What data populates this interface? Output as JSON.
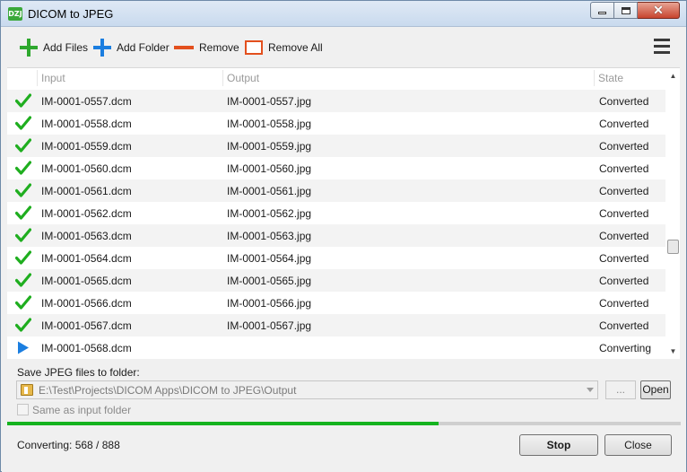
{
  "window": {
    "title": "DICOM to JPEG",
    "app_icon_text": "DZJ"
  },
  "toolbar": {
    "add_files": "Add Files",
    "add_folder": "Add Folder",
    "remove": "Remove",
    "remove_all": "Remove All"
  },
  "list": {
    "columns": {
      "input": "Input",
      "output": "Output",
      "state": "State"
    },
    "rows": [
      {
        "input": "IM-0001-0557.dcm",
        "output": "IM-0001-0557.jpg",
        "state": "Converted",
        "icon": "check-icon"
      },
      {
        "input": "IM-0001-0558.dcm",
        "output": "IM-0001-0558.jpg",
        "state": "Converted",
        "icon": "check-icon"
      },
      {
        "input": "IM-0001-0559.dcm",
        "output": "IM-0001-0559.jpg",
        "state": "Converted",
        "icon": "check-icon"
      },
      {
        "input": "IM-0001-0560.dcm",
        "output": "IM-0001-0560.jpg",
        "state": "Converted",
        "icon": "check-icon"
      },
      {
        "input": "IM-0001-0561.dcm",
        "output": "IM-0001-0561.jpg",
        "state": "Converted",
        "icon": "check-icon"
      },
      {
        "input": "IM-0001-0562.dcm",
        "output": "IM-0001-0562.jpg",
        "state": "Converted",
        "icon": "check-icon"
      },
      {
        "input": "IM-0001-0563.dcm",
        "output": "IM-0001-0563.jpg",
        "state": "Converted",
        "icon": "check-icon"
      },
      {
        "input": "IM-0001-0564.dcm",
        "output": "IM-0001-0564.jpg",
        "state": "Converted",
        "icon": "check-icon"
      },
      {
        "input": "IM-0001-0565.dcm",
        "output": "IM-0001-0565.jpg",
        "state": "Converted",
        "icon": "check-icon"
      },
      {
        "input": "IM-0001-0566.dcm",
        "output": "IM-0001-0566.jpg",
        "state": "Converted",
        "icon": "check-icon"
      },
      {
        "input": "IM-0001-0567.dcm",
        "output": "IM-0001-0567.jpg",
        "state": "Converted",
        "icon": "check-icon"
      },
      {
        "input": "IM-0001-0568.dcm",
        "output": "",
        "state": "Converting",
        "icon": "play-icon"
      }
    ]
  },
  "output": {
    "label": "Save JPEG files to folder:",
    "path": "E:\\Test\\Projects\\DICOM Apps\\DICOM to JPEG\\Output",
    "browse_label": "...",
    "open_label": "Open",
    "same_as_input_label": "Same as input folder",
    "same_as_input_checked": false
  },
  "progress": {
    "fraction": 0.64
  },
  "status": {
    "text": "Converting: 568 / 888"
  },
  "buttons": {
    "stop": "Stop",
    "close": "Close"
  },
  "colors": {
    "check": "#1fae1f",
    "play": "#1b7ee0",
    "progress": "#15b31f",
    "remove_accent": "#e3501e"
  }
}
